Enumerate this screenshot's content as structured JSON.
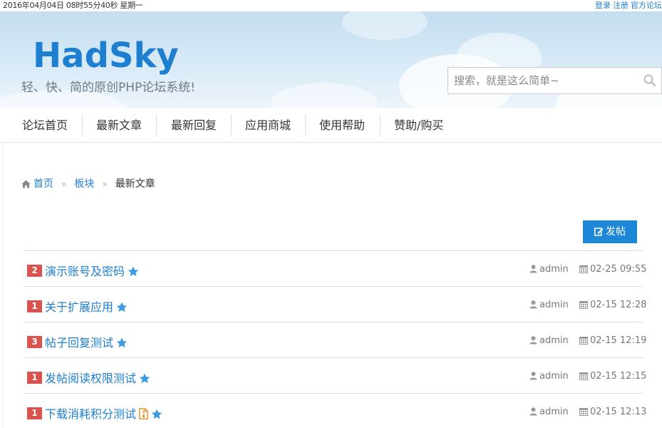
{
  "topbar": {
    "datetime": "2016年04月04日 08时55分40秒 星期一",
    "login": "登录",
    "register": "注册",
    "official": "官方论坛"
  },
  "header": {
    "logo": "HadSky",
    "tagline": "轻、快、简的原创PHP论坛系统!",
    "search_placeholder": "搜索，就是这么简单~"
  },
  "nav": {
    "items": [
      {
        "label": "论坛首页"
      },
      {
        "label": "最新文章"
      },
      {
        "label": "最新回复"
      },
      {
        "label": "应用商城"
      },
      {
        "label": "使用帮助"
      },
      {
        "label": "赞助/购买"
      }
    ]
  },
  "breadcrumb": {
    "home": "首页",
    "board": "板块",
    "current": "最新文章",
    "sep": "»"
  },
  "post_button": {
    "label": "发帖"
  },
  "posts": [
    {
      "count": "2",
      "title": "演示账号及密码",
      "author": "admin",
      "date": "02-25 09:55",
      "has_file": false
    },
    {
      "count": "1",
      "title": "关于扩展应用",
      "author": "admin",
      "date": "02-15 12:28",
      "has_file": false
    },
    {
      "count": "3",
      "title": "帖子回复测试",
      "author": "admin",
      "date": "02-15 12:19",
      "has_file": false
    },
    {
      "count": "1",
      "title": "发帖阅读权限测试",
      "author": "admin",
      "date": "02-15 12:15",
      "has_file": false
    },
    {
      "count": "1",
      "title": "下载消耗积分测试",
      "author": "admin",
      "date": "02-15 12:13",
      "has_file": true
    }
  ],
  "colors": {
    "accent": "#1e7fd0",
    "badge": "#d9534f",
    "button": "#1e88d8",
    "star": "#3a9be0"
  }
}
